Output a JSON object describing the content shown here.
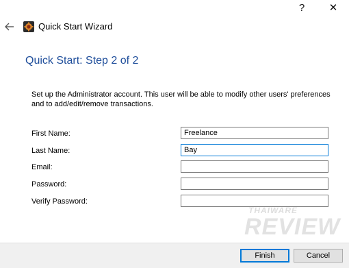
{
  "titlebar": {
    "help_glyph": "?",
    "close_glyph": "✕"
  },
  "header": {
    "title": "Quick Start Wizard"
  },
  "step": {
    "title": "Quick Start: Step 2 of 2"
  },
  "description": "Set up the Administrator account. This user will be able to modify other users' preferences and to add/edit/remove transactions.",
  "form": {
    "first_name": {
      "label": "First Name:",
      "value": "Freelance"
    },
    "last_name": {
      "label": "Last Name:",
      "value": "Bay"
    },
    "email": {
      "label": "Email:",
      "value": ""
    },
    "password": {
      "label": "Password:",
      "value": ""
    },
    "verify_password": {
      "label": "Verify Password:",
      "value": ""
    }
  },
  "buttons": {
    "finish": "Finish",
    "cancel": "Cancel"
  },
  "watermark": {
    "top": "THAIWARE",
    "main": "REVIEW"
  },
  "colors": {
    "accent": "#0078d7",
    "step_title": "#1f4e9b",
    "footer_bg": "#f0f0f0"
  },
  "icons": {
    "back": "back-arrow-icon",
    "app": "app-icon"
  }
}
